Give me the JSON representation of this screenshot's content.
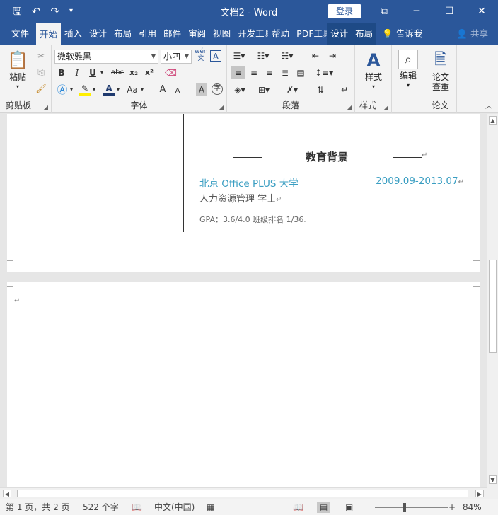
{
  "titlebar": {
    "doc_title": "文档2 - Word",
    "login_label": "登录",
    "qat_icons": [
      "save-icon",
      "undo-icon",
      "redo-icon",
      "customize-icon"
    ]
  },
  "tabs": [
    "文件",
    "开始",
    "插入",
    "设计",
    "布局",
    "引用",
    "邮件",
    "审阅",
    "视图",
    "开发工具",
    "帮助",
    "PDF工具",
    "设计",
    "布局"
  ],
  "active_tab": "开始",
  "tell_me": "告诉我",
  "share": "共享",
  "ribbon": {
    "clipboard": {
      "label": "剪贴板",
      "paste": "粘贴"
    },
    "font": {
      "label": "字体",
      "font_name": "微软雅黑",
      "font_size": "小四",
      "phonetic": "wén\n文",
      "border_char": "A",
      "bold": "B",
      "italic": "I",
      "underline": "U",
      "strike": "abc",
      "sub": "x₂",
      "sup": "x²",
      "grow": "A",
      "shrink": "A",
      "aa": "Aa",
      "char_shade": "A",
      "enclose": "字"
    },
    "paragraph": {
      "label": "段落"
    },
    "styles": {
      "label": "样式",
      "button": "样式"
    },
    "editing": {
      "button": "编辑"
    },
    "paper": {
      "label": "论文",
      "button_line1": "论文",
      "button_line2": "查重"
    }
  },
  "document": {
    "heading": "教育背景",
    "university": "北京 Office PLUS 大学",
    "date_range": "2009.09-2013.07",
    "major": "人力资源管理  学士",
    "gpa": "GPA：3.6/4.0    班级排名  1/36",
    "para_mark": "↵"
  },
  "statusbar": {
    "page": "第 1 页，共 2 页",
    "words": "522 个字",
    "language": "中文(中国)",
    "zoom": "84%",
    "zoom_minus": "－",
    "zoom_plus": "+"
  },
  "colors": {
    "accent": "#2b579a",
    "doc_blue": "#3a9ec2"
  }
}
